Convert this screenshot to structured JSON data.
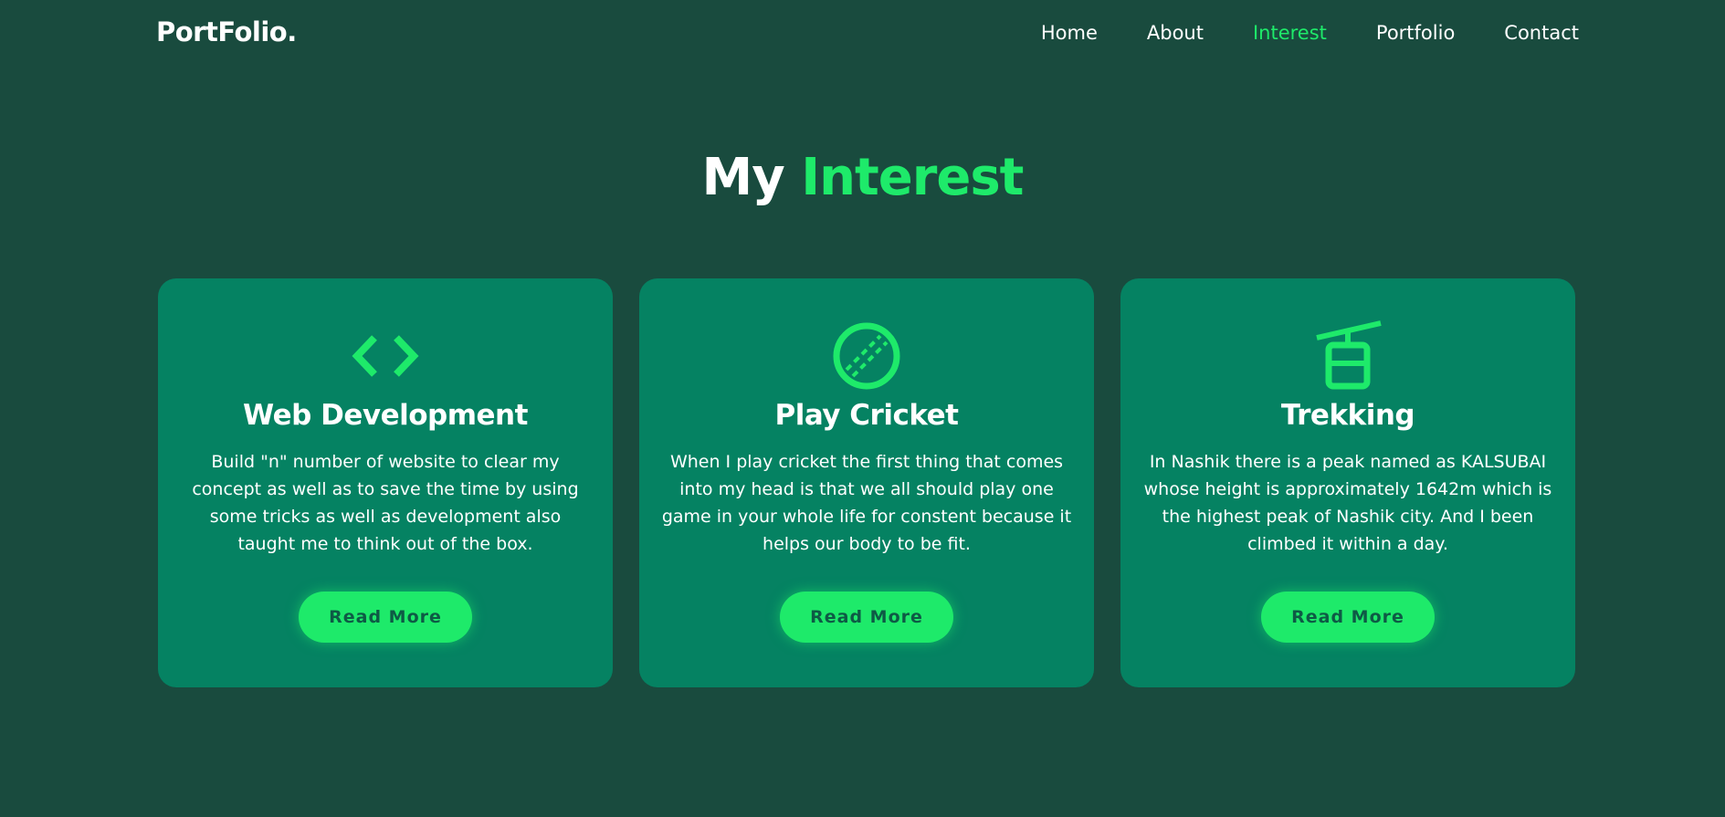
{
  "header": {
    "logo": "PortFolio.",
    "nav": [
      {
        "label": "Home"
      },
      {
        "label": "About"
      },
      {
        "label": "Interest",
        "active": true
      },
      {
        "label": "Portfolio"
      },
      {
        "label": "Contact"
      }
    ]
  },
  "section": {
    "title_plain": "My",
    "title_accent": "Interest"
  },
  "cards": [
    {
      "icon": "code-icon",
      "title": "Web Development",
      "text": "Build \"n\" number of website to clear my concept as well as to save the time by using some tricks as well as development also taught me to think out of the box.",
      "button": "Read More"
    },
    {
      "icon": "cricket-ball-icon",
      "title": "Play Cricket",
      "text": "When I play cricket the first thing that comes into my head is that we all should play one game in your whole life for constent because it helps our body to be fit.",
      "button": "Read More"
    },
    {
      "icon": "cable-car-icon",
      "title": "Trekking",
      "text": "In Nashik there is a peak named as KALSUBAI whose height is approximately 1642m which is the highest peak of Nashik city. And I been climbed it within a day.",
      "button": "Read More"
    }
  ],
  "colors": {
    "background": "#194b3e",
    "card": "#058262",
    "accent": "#1eea6a",
    "button_text": "#0e5a45"
  }
}
